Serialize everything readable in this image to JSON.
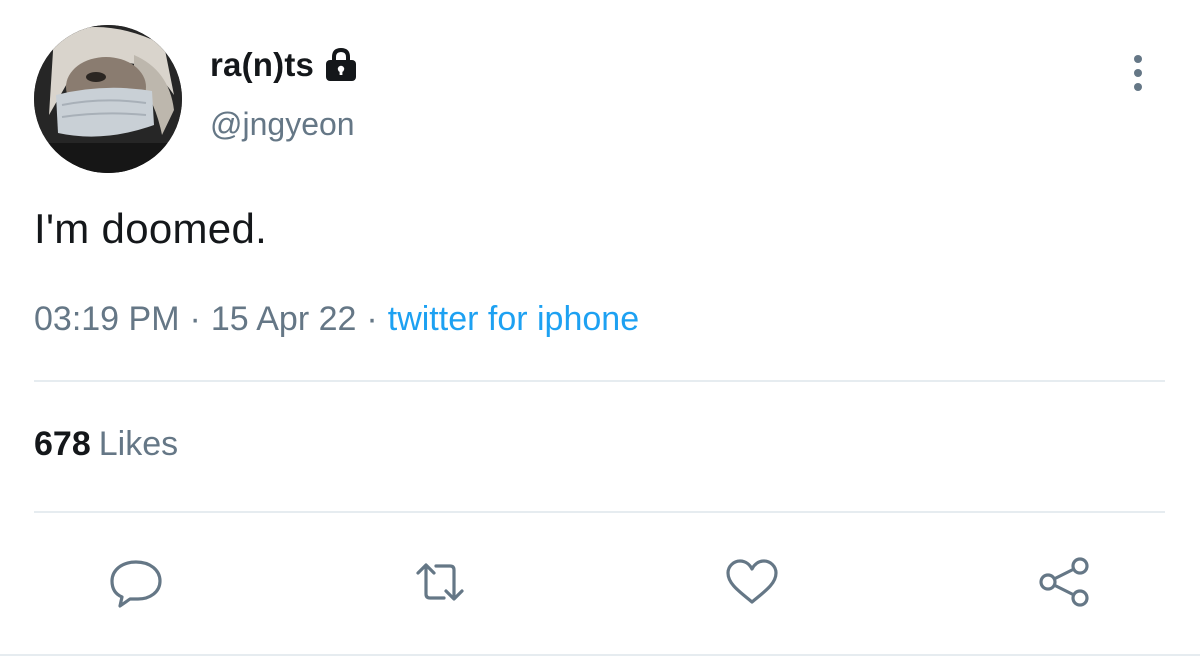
{
  "tweet": {
    "display_name": "ra(n)ts",
    "handle": "@jngyeon",
    "text": "I'm doomed.",
    "time": "03:19 PM",
    "separator": "·",
    "date": "15 Apr 22",
    "source": "twitter for iphone",
    "likes_count": "678",
    "likes_label": "Likes"
  },
  "icons": {
    "lock": "lock-icon",
    "more": "more-vertical-icon",
    "reply": "reply-icon",
    "retweet": "retweet-icon",
    "like": "heart-icon",
    "share": "share-icon"
  },
  "colors": {
    "text_primary": "#14171a",
    "text_secondary": "#657786",
    "link": "#1da1f2",
    "divider": "#e6ecf0"
  }
}
